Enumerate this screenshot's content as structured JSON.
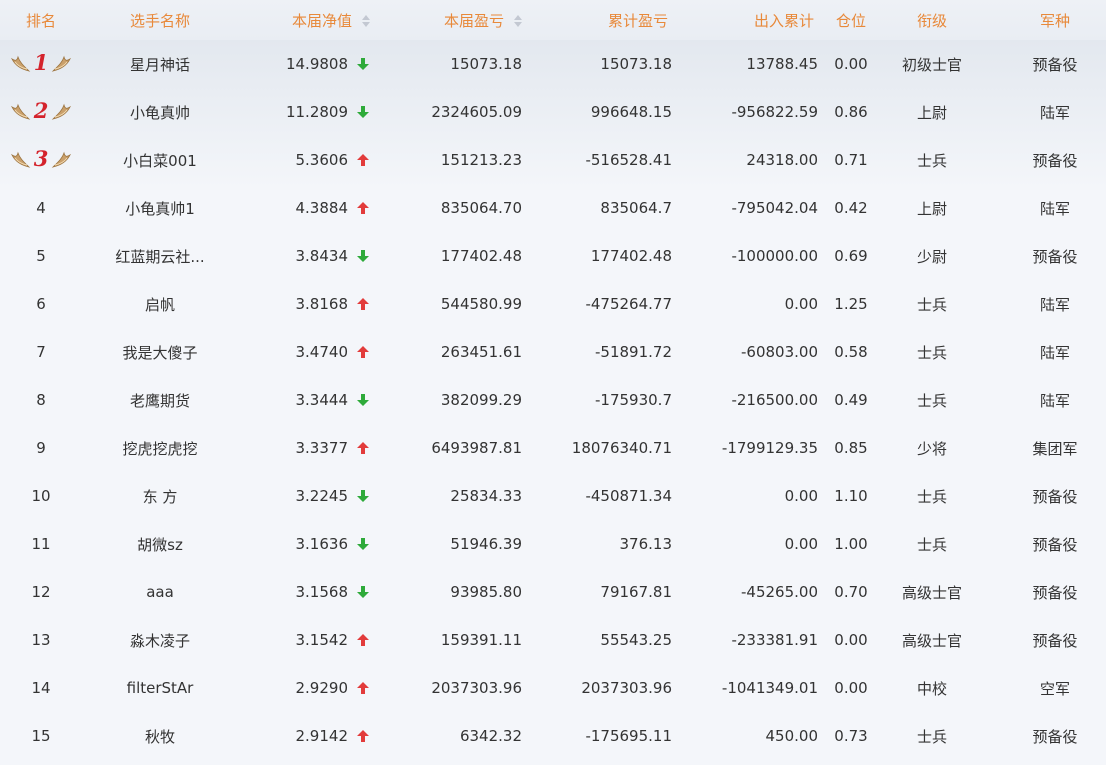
{
  "headers": {
    "rank": "排名",
    "name": "选手名称",
    "nav": "本届净值",
    "profit": "本届盈亏",
    "cumulative": "累计盈亏",
    "inout": "出入累计",
    "position": "仓位",
    "rank_title": "衔级",
    "army": "军种"
  },
  "colors": {
    "header_text": "#e8893a",
    "up": "#e23b3b",
    "down": "#2eaa3a",
    "medal_number": "#d4232c",
    "wing": "#caa06b"
  },
  "rows": [
    {
      "rank": "1",
      "medal": true,
      "name": "星月神话",
      "nav": "14.9808",
      "trend": "down",
      "profit": "15073.18",
      "cumulative": "15073.18",
      "inout": "13788.45",
      "position": "0.00",
      "rank_title": "初级士官",
      "army": "预备役"
    },
    {
      "rank": "2",
      "medal": true,
      "name": "小龟真帅",
      "nav": "11.2809",
      "trend": "down",
      "profit": "2324605.09",
      "cumulative": "996648.15",
      "inout": "-956822.59",
      "position": "0.86",
      "rank_title": "上尉",
      "army": "陆军"
    },
    {
      "rank": "3",
      "medal": true,
      "name": "小白菜001",
      "nav": "5.3606",
      "trend": "up",
      "profit": "151213.23",
      "cumulative": "-516528.41",
      "inout": "24318.00",
      "position": "0.71",
      "rank_title": "士兵",
      "army": "预备役"
    },
    {
      "rank": "4",
      "medal": false,
      "name": "小龟真帅1",
      "nav": "4.3884",
      "trend": "up",
      "profit": "835064.70",
      "cumulative": "835064.7",
      "inout": "-795042.04",
      "position": "0.42",
      "rank_title": "上尉",
      "army": "陆军"
    },
    {
      "rank": "5",
      "medal": false,
      "name": "红蓝期云社...",
      "nav": "3.8434",
      "trend": "down",
      "profit": "177402.48",
      "cumulative": "177402.48",
      "inout": "-100000.00",
      "position": "0.69",
      "rank_title": "少尉",
      "army": "预备役"
    },
    {
      "rank": "6",
      "medal": false,
      "name": "启帆",
      "nav": "3.8168",
      "trend": "up",
      "profit": "544580.99",
      "cumulative": "-475264.77",
      "inout": "0.00",
      "position": "1.25",
      "rank_title": "士兵",
      "army": "陆军"
    },
    {
      "rank": "7",
      "medal": false,
      "name": "我是大傻子",
      "nav": "3.4740",
      "trend": "up",
      "profit": "263451.61",
      "cumulative": "-51891.72",
      "inout": "-60803.00",
      "position": "0.58",
      "rank_title": "士兵",
      "army": "陆军"
    },
    {
      "rank": "8",
      "medal": false,
      "name": "老鹰期货",
      "nav": "3.3444",
      "trend": "down",
      "profit": "382099.29",
      "cumulative": "-175930.7",
      "inout": "-216500.00",
      "position": "0.49",
      "rank_title": "士兵",
      "army": "陆军"
    },
    {
      "rank": "9",
      "medal": false,
      "name": "挖虎挖虎挖",
      "nav": "3.3377",
      "trend": "up",
      "profit": "6493987.81",
      "cumulative": "18076340.71",
      "inout": "-1799129.35",
      "position": "0.85",
      "rank_title": "少将",
      "army": "集团军"
    },
    {
      "rank": "10",
      "medal": false,
      "name": "东 方",
      "nav": "3.2245",
      "trend": "down",
      "profit": "25834.33",
      "cumulative": "-450871.34",
      "inout": "0.00",
      "position": "1.10",
      "rank_title": "士兵",
      "army": "预备役"
    },
    {
      "rank": "11",
      "medal": false,
      "name": "胡微sz",
      "nav": "3.1636",
      "trend": "down",
      "profit": "51946.39",
      "cumulative": "376.13",
      "inout": "0.00",
      "position": "1.00",
      "rank_title": "士兵",
      "army": "预备役"
    },
    {
      "rank": "12",
      "medal": false,
      "name": "aaa",
      "nav": "3.1568",
      "trend": "down",
      "profit": "93985.80",
      "cumulative": "79167.81",
      "inout": "-45265.00",
      "position": "0.70",
      "rank_title": "高级士官",
      "army": "预备役"
    },
    {
      "rank": "13",
      "medal": false,
      "name": "淼木凌子",
      "nav": "3.1542",
      "trend": "up",
      "profit": "159391.11",
      "cumulative": "55543.25",
      "inout": "-233381.91",
      "position": "0.00",
      "rank_title": "高级士官",
      "army": "预备役"
    },
    {
      "rank": "14",
      "medal": false,
      "name": "filterStAr",
      "nav": "2.9290",
      "trend": "up",
      "profit": "2037303.96",
      "cumulative": "2037303.96",
      "inout": "-1041349.01",
      "position": "0.00",
      "rank_title": "中校",
      "army": "空军"
    },
    {
      "rank": "15",
      "medal": false,
      "name": "秋牧",
      "nav": "2.9142",
      "trend": "up",
      "profit": "6342.32",
      "cumulative": "-175695.11",
      "inout": "450.00",
      "position": "0.73",
      "rank_title": "士兵",
      "army": "预备役"
    }
  ]
}
